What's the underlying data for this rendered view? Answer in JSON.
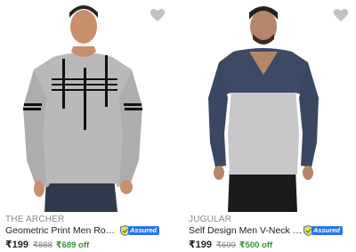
{
  "colors": {
    "accent": "#2874f0",
    "discount": "#388e3c",
    "wishlist": "#c2c2c2"
  },
  "products": [
    {
      "brand": "THE ARCHER",
      "title": "Geometric Print Men Round or Cre...",
      "assured_label": "Assured",
      "price": "₹199",
      "mrp": "₹888",
      "discount": "₹689 off",
      "wishlist_icon": "heart-icon"
    },
    {
      "brand": "JUGULAR",
      "title": "Self Design Men V-Neck Multicolo...",
      "assured_label": "Assured",
      "price": "₹199",
      "mrp": "₹699",
      "discount": "₹500 off",
      "wishlist_icon": "heart-icon"
    }
  ]
}
